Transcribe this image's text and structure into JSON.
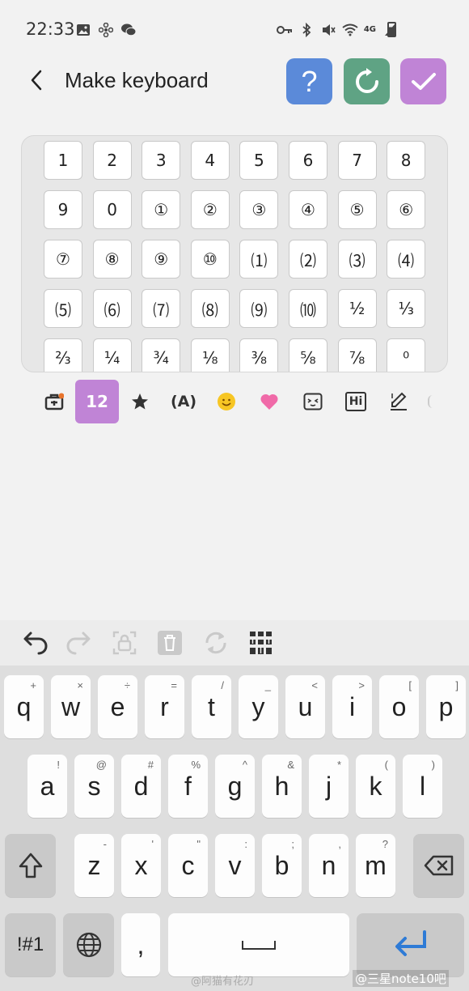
{
  "status": {
    "time": "22:33",
    "network": "4G"
  },
  "header": {
    "title": "Make keyboard",
    "help_label": "?"
  },
  "symbols": [
    "1",
    "2",
    "3",
    "4",
    "5",
    "6",
    "7",
    "8",
    "9",
    "0",
    "①",
    "②",
    "③",
    "④",
    "⑤",
    "⑥",
    "⑦",
    "⑧",
    "⑨",
    "⑩",
    "⑴",
    "⑵",
    "⑶",
    "⑷",
    "⑸",
    "⑹",
    "⑺",
    "⑻",
    "⑼",
    "⑽",
    "½",
    "⅓",
    "⅔",
    "¼",
    "¾",
    "⅛",
    "⅜",
    "⅝",
    "⅞",
    "⁰"
  ],
  "categories": {
    "numbers_label": "12",
    "circled_label": "(A)",
    "hi_label": "Hi"
  },
  "keyboard": {
    "row1": [
      {
        "main": "q",
        "sub": "+"
      },
      {
        "main": "w",
        "sub": "×"
      },
      {
        "main": "e",
        "sub": "÷"
      },
      {
        "main": "r",
        "sub": "="
      },
      {
        "main": "t",
        "sub": "/"
      },
      {
        "main": "y",
        "sub": "_"
      },
      {
        "main": "u",
        "sub": "<"
      },
      {
        "main": "i",
        "sub": ">"
      },
      {
        "main": "o",
        "sub": "["
      },
      {
        "main": "p",
        "sub": "]"
      }
    ],
    "row2": [
      {
        "main": "a",
        "sub": "!"
      },
      {
        "main": "s",
        "sub": "@"
      },
      {
        "main": "d",
        "sub": "#"
      },
      {
        "main": "f",
        "sub": "%"
      },
      {
        "main": "g",
        "sub": "^"
      },
      {
        "main": "h",
        "sub": "&"
      },
      {
        "main": "j",
        "sub": "*"
      },
      {
        "main": "k",
        "sub": "("
      },
      {
        "main": "l",
        "sub": ")"
      }
    ],
    "row3": [
      {
        "main": "z",
        "sub": "-"
      },
      {
        "main": "x",
        "sub": "'"
      },
      {
        "main": "c",
        "sub": "\""
      },
      {
        "main": "v",
        "sub": ":"
      },
      {
        "main": "b",
        "sub": ";"
      },
      {
        "main": "n",
        "sub": ","
      },
      {
        "main": "m",
        "sub": "?"
      }
    ],
    "symbols_label": "!#1",
    "comma_label": ","
  },
  "watermark": {
    "left": "@阿猫有花刃",
    "right": "@三星note10吧"
  },
  "colors": {
    "help": "#5b8ad9",
    "reset": "#5fa384",
    "done": "#c084d6",
    "enter": "#2e7bd6"
  }
}
